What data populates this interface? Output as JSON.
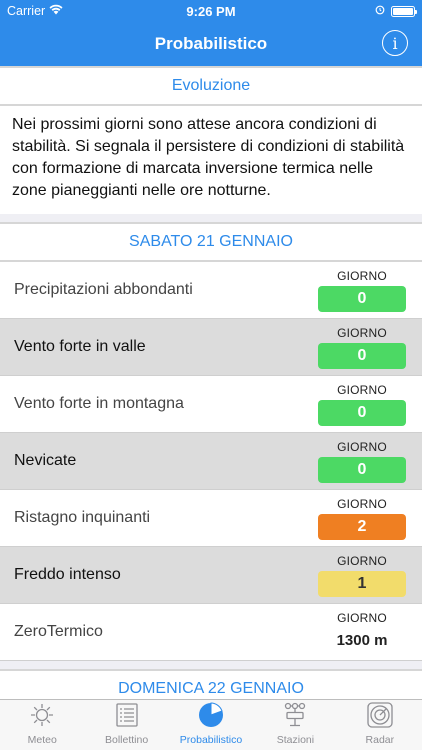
{
  "status_bar": {
    "carrier": "Carrier",
    "time": "9:26 PM"
  },
  "nav": {
    "title": "Probabilistico",
    "info_glyph": "i"
  },
  "evolution": {
    "header": "Evoluzione",
    "text": "Nei prossimi giorni sono attese ancora condizioni di stabilità. Si segnala il persistere di condizioni di stabilità con formazione di marcata inversione termica nelle zone pianeggianti nelle ore notturne."
  },
  "day1": {
    "header": "SABATO 21 GENNAIO",
    "rows": [
      {
        "label": "Precipitazioni abbondanti",
        "caption": "GIORNO",
        "value": "0",
        "color": "#4cd964",
        "text_color": "#ffffff"
      },
      {
        "label": "Vento forte in valle",
        "caption": "GIORNO",
        "value": "0",
        "color": "#4cd964",
        "text_color": "#ffffff"
      },
      {
        "label": "Vento forte in montagna",
        "caption": "GIORNO",
        "value": "0",
        "color": "#4cd964",
        "text_color": "#ffffff"
      },
      {
        "label": "Nevicate",
        "caption": "GIORNO",
        "value": "0",
        "color": "#4cd964",
        "text_color": "#ffffff"
      },
      {
        "label": "Ristagno inquinanti",
        "caption": "GIORNO",
        "value": "2",
        "color": "#ef7f22",
        "text_color": "#ffffff"
      },
      {
        "label": "Freddo intenso",
        "caption": "GIORNO",
        "value": "1",
        "color": "#f2dc6b",
        "text_color": "#333333"
      },
      {
        "label": "ZeroTermico",
        "caption": "GIORNO",
        "value": "1300 m"
      }
    ]
  },
  "day2": {
    "header": "DOMENICA 22 GENNAIO"
  },
  "tabs": [
    {
      "label": "Meteo",
      "icon": "sun-icon"
    },
    {
      "label": "Bollettino",
      "icon": "document-icon"
    },
    {
      "label": "Probabilistico",
      "icon": "pie-chart-icon",
      "active": true
    },
    {
      "label": "Stazioni",
      "icon": "station-icon"
    },
    {
      "label": "Radar",
      "icon": "radar-icon"
    }
  ],
  "colors": {
    "accent": "#2e8bea",
    "green": "#4cd964",
    "orange": "#ef7f22",
    "yellow": "#f2dc6b"
  }
}
